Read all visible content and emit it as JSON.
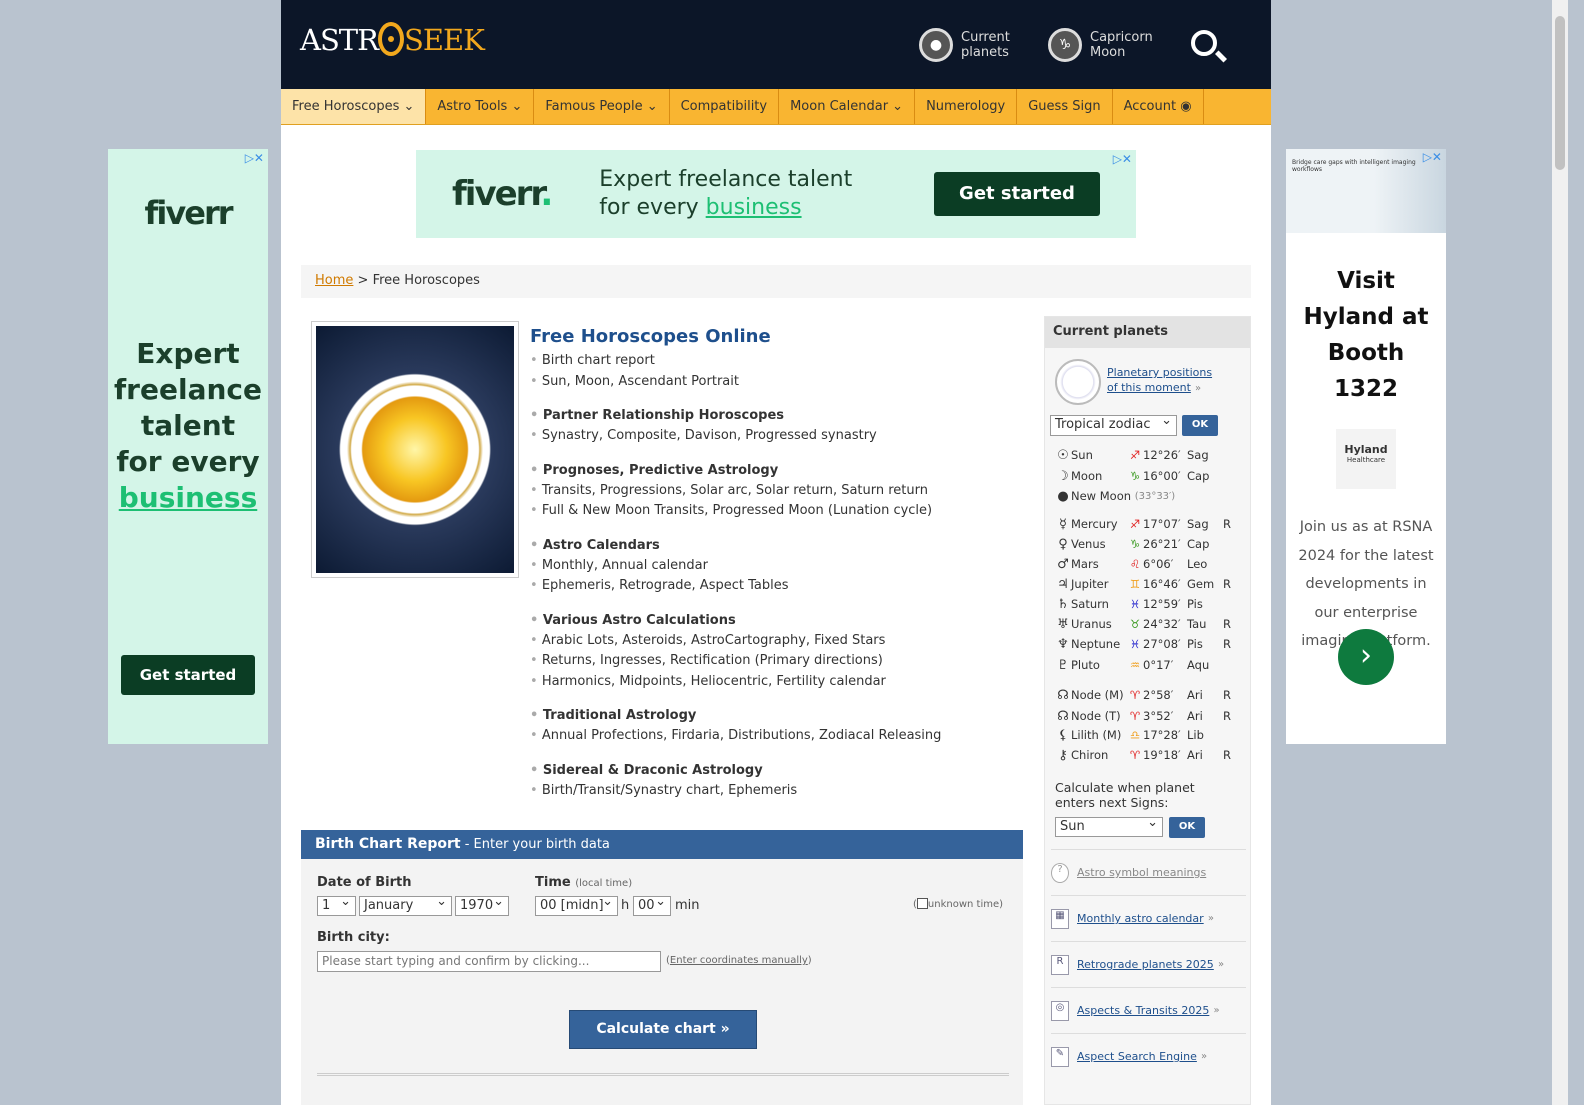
{
  "header": {
    "logo": "ASTROSEEK",
    "logo_astr": "ASTR",
    "logo_seek": "SEEK",
    "current_planets": [
      "Current",
      "planets"
    ],
    "moon_link": [
      "Capricorn",
      "Moon"
    ]
  },
  "nav": [
    "Free Horoscopes ⌄",
    "Astro Tools ⌄",
    "Famous People ⌄",
    "Compatibility",
    "Moon Calendar ⌄",
    "Numerology",
    "Guess Sign",
    "Account"
  ],
  "ads": {
    "top": {
      "brand": "fiverr",
      "line1": "Expert freelance talent",
      "line2a": "for every ",
      "line2b": "business",
      "cta": "Get started"
    },
    "left": {
      "brand": "fiverr",
      "text": [
        "Expert",
        "freelance",
        "talent",
        "for every"
      ],
      "highlight": "business",
      "cta": "Get started"
    },
    "right": {
      "title": "Visit Hyland at Booth 1322",
      "brand": "Hyland",
      "brand_sub": "Healthcare",
      "body": "Join us as at RSNA 2024 for the latest developments in our enterprise imaging platform.",
      "banner_text": "Bridge care gaps with intelligent imaging workflows"
    }
  },
  "breadcrumb": {
    "home": "Home",
    "sep": ">",
    "current": "Free Horoscopes"
  },
  "main": {
    "title": "Free Horoscopes Online",
    "groups": [
      {
        "heading": "",
        "items": [
          "Birth chart report",
          "Sun, Moon, Ascendant Portrait"
        ]
      },
      {
        "heading": "Partner Relationship Horoscopes",
        "items": [
          "Synastry, Composite, Davison, Progressed synastry"
        ]
      },
      {
        "heading": "Prognoses, Predictive Astrology",
        "items": [
          "Transits, Progressions, Solar arc, Solar return, Saturn return",
          "Full & New Moon Transits, Progressed Moon (Lunation cycle)"
        ]
      },
      {
        "heading": "Astro Calendars",
        "items": [
          "Monthly, Annual calendar",
          "Ephemeris, Retrograde, Aspect Tables"
        ]
      },
      {
        "heading": "Various Astro Calculations",
        "items": [
          "Arabic Lots, Asteroids, AstroCartography, Fixed Stars",
          "Returns, Ingresses, Rectification (Primary directions)",
          "Harmonics, Midpoints, Heliocentric, Fertility calendar"
        ]
      },
      {
        "heading": "Traditional Astrology",
        "items": [
          "Annual Profections, Firdaria, Distributions, Zodiacal Releasing"
        ]
      },
      {
        "heading": "Sidereal & Draconic Astrology",
        "items": [
          "Birth/Transit/Synastry chart, Ephemeris"
        ]
      }
    ]
  },
  "form": {
    "title": "Birth Chart Report",
    "subtitle": " - Enter your birth data",
    "dob_label": "Date of Birth",
    "day": "1",
    "month": "January",
    "year": "1970",
    "time_label": "Time",
    "time_note": "(local time)",
    "hour": "00 [midn]",
    "h": "h",
    "minute": "00",
    "min": "min",
    "unknown_time": "unknown time",
    "city_label": "Birth city:",
    "city_placeholder": "Please start typing and confirm by clicking...",
    "coords_link": "Enter coordinates manually",
    "submit": "Calculate chart »"
  },
  "sidebar": {
    "title": "Current planets",
    "positions_link": [
      "Planetary positions",
      "of this moment"
    ],
    "zodiac": "Tropical zodiac",
    "ok": "OK",
    "planets": [
      {
        "glyph": "☉",
        "name": "Sun",
        "sign_glyph": "♐",
        "color": "#e02020",
        "deg": "12°26′",
        "sign": "Sag",
        "r": ""
      },
      {
        "glyph": "☽",
        "name": "Moon",
        "sign_glyph": "♑",
        "color": "#3a9a20",
        "deg": "16°00′",
        "sign": "Cap",
        "r": ""
      },
      {
        "glyph": "●",
        "name": "New Moon",
        "extra": "(33°33′)"
      },
      {
        "glyph": "☿",
        "name": "Mercury",
        "sign_glyph": "♐",
        "color": "#e02020",
        "deg": "17°07′",
        "sign": "Sag",
        "r": "R"
      },
      {
        "glyph": "♀",
        "name": "Venus",
        "sign_glyph": "♑",
        "color": "#3a9a20",
        "deg": "26°21′",
        "sign": "Cap",
        "r": ""
      },
      {
        "glyph": "♂",
        "name": "Mars",
        "sign_glyph": "♌",
        "color": "#e02020",
        "deg": "6°06′",
        "sign": "Leo",
        "r": ""
      },
      {
        "glyph": "♃",
        "name": "Jupiter",
        "sign_glyph": "♊",
        "color": "#f0a020",
        "deg": "16°46′",
        "sign": "Gem",
        "r": "R"
      },
      {
        "glyph": "♄",
        "name": "Saturn",
        "sign_glyph": "♓",
        "color": "#3030d0",
        "deg": "12°59′",
        "sign": "Pis",
        "r": ""
      },
      {
        "glyph": "♅",
        "name": "Uranus",
        "sign_glyph": "♉",
        "color": "#3a9a20",
        "deg": "24°32′",
        "sign": "Tau",
        "r": "R"
      },
      {
        "glyph": "♆",
        "name": "Neptune",
        "sign_glyph": "♓",
        "color": "#3030d0",
        "deg": "27°08′",
        "sign": "Pis",
        "r": "R"
      },
      {
        "glyph": "♇",
        "name": "Pluto",
        "sign_glyph": "♒",
        "color": "#f0a020",
        "deg": "0°17′",
        "sign": "Aqu",
        "r": ""
      },
      {
        "glyph": "☊",
        "name": "Node (M)",
        "sign_glyph": "♈",
        "color": "#e02020",
        "deg": "2°58′",
        "sign": "Ari",
        "r": "R"
      },
      {
        "glyph": "☊",
        "name": "Node (T)",
        "sign_glyph": "♈",
        "color": "#e02020",
        "deg": "3°52′",
        "sign": "Ari",
        "r": "R"
      },
      {
        "glyph": "⚸",
        "name": "Lilith (M)",
        "sign_glyph": "♎",
        "color": "#f0a020",
        "deg": "17°28′",
        "sign": "Lib",
        "r": ""
      },
      {
        "glyph": "⚷",
        "name": "Chiron",
        "sign_glyph": "♈",
        "color": "#e02020",
        "deg": "19°18′",
        "sign": "Ari",
        "r": "R"
      }
    ],
    "next_sign_label": "Calculate when planet enters next Signs:",
    "next_sign_planet": "Sun",
    "links": [
      {
        "icon": "?",
        "label": "Astro symbol meanings",
        "arrow": ""
      },
      {
        "icon": "▦",
        "label": "Monthly astro calendar",
        "arrow": "»"
      },
      {
        "icon": "R",
        "label": "Retrograde planets 2025",
        "arrow": "»"
      },
      {
        "icon": "◎",
        "label": "Aspects & Transits 2025",
        "arrow": "»"
      },
      {
        "icon": "✎",
        "label": "Aspect Search Engine",
        "arrow": "»"
      }
    ]
  }
}
